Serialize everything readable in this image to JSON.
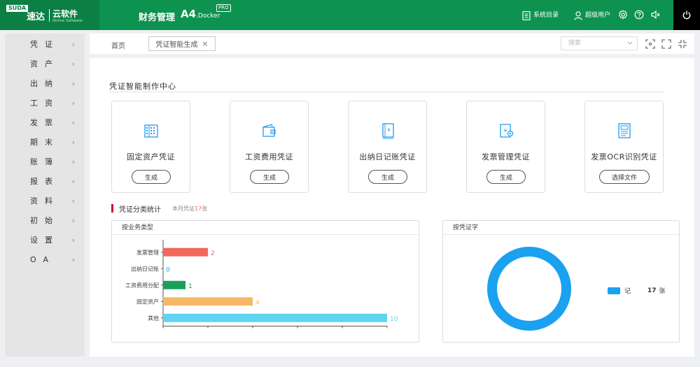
{
  "header": {
    "logo_badge": "SUDA",
    "logo_name": "速达",
    "logo_cloud": "云软件",
    "logo_sub": "Online Software",
    "app_name": "财务管理",
    "brand_main": "A4",
    "brand_sub": ".Docker",
    "brand_badge": "PRO",
    "catalog_label": "系统目录",
    "user_label": "超级用户",
    "icons": [
      "catalog-icon",
      "user-icon",
      "settings-icon",
      "help-icon",
      "speaker-icon",
      "power-icon"
    ]
  },
  "sidebar": {
    "items": [
      {
        "label": "凭证"
      },
      {
        "label": "资产"
      },
      {
        "label": "出纳"
      },
      {
        "label": "工资"
      },
      {
        "label": "发票"
      },
      {
        "label": "期末"
      },
      {
        "label": "账簿"
      },
      {
        "label": "报表"
      },
      {
        "label": "资料"
      },
      {
        "label": "初始"
      },
      {
        "label": "设置"
      },
      {
        "label": "OA"
      }
    ],
    "chevron": "›"
  },
  "tabs": {
    "home": "首页",
    "active": "凭证智能生成",
    "close": "×",
    "search_placeholder": "搜索"
  },
  "main": {
    "title": "凭证智能制作中心",
    "cards": [
      {
        "label": "固定资产凭证",
        "button": "生成",
        "icon": "building-icon"
      },
      {
        "label": "工资费用凭证",
        "button": "生成",
        "icon": "wallet-icon"
      },
      {
        "label": "出纳日记账凭证",
        "button": "生成",
        "icon": "cash-book-icon"
      },
      {
        "label": "发票管理凭证",
        "button": "生成",
        "icon": "invoice-icon"
      },
      {
        "label": "发票OCR识别凭证",
        "button": "选择文件",
        "icon": "ocr-receipt-icon"
      }
    ],
    "stats_title": "凭证分类统计",
    "stats_sub_prefix": "本月凭证",
    "stats_sub_count": "17",
    "stats_sub_suffix": "张",
    "panel_left_title": "按业务类型",
    "panel_right_title": "按凭证字",
    "legend_label": "记",
    "legend_count": "17",
    "legend_unit": "张"
  },
  "chart_data": [
    {
      "type": "bar",
      "orientation": "horizontal",
      "categories": [
        "发票管理",
        "出纳日记账",
        "工资费用分配",
        "固定资产",
        "其他"
      ],
      "values": [
        2,
        0,
        1,
        4,
        10
      ],
      "colors": [
        "#f2685a",
        "#1aa1f0",
        "#19a15a",
        "#f7b865",
        "#5fd4f0"
      ],
      "xlim": [
        0,
        10
      ]
    },
    {
      "type": "pie",
      "donut": true,
      "labels": [
        "记"
      ],
      "values": [
        17
      ],
      "colors": [
        "#1aa1f0"
      ]
    }
  ]
}
